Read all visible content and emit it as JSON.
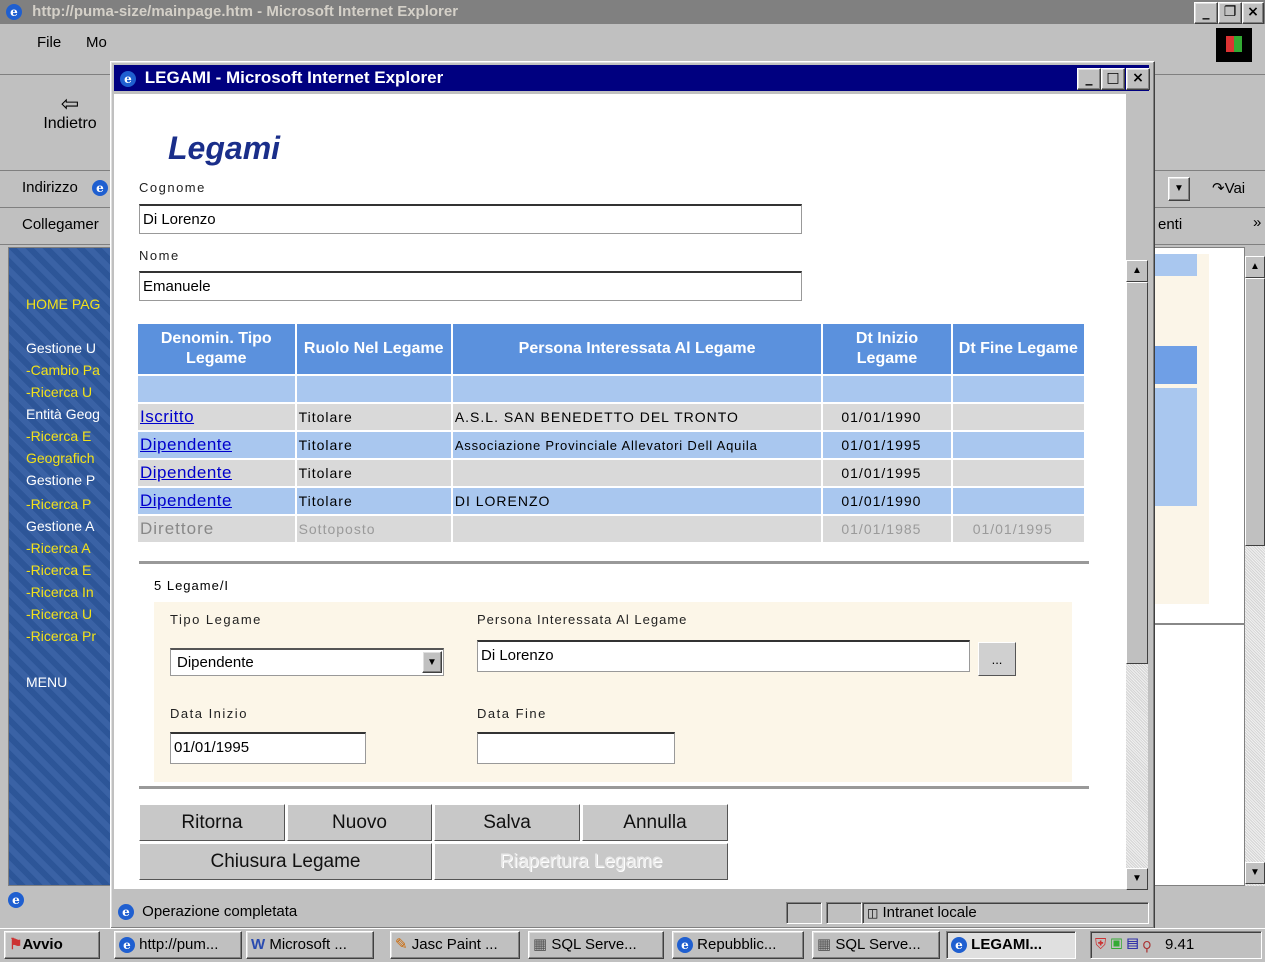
{
  "outer_window": {
    "title": "http://puma-size/mainpage.htm - Microsoft Internet Explorer",
    "menu": [
      "File",
      "Mo"
    ],
    "back_label": "Indietro",
    "address_label": "Indirizzo",
    "go_label": "Vai",
    "links_label": "Collegamer",
    "links_right": "enti",
    "status_text": "",
    "left_menu": [
      {
        "text": "HOME PAG",
        "color": "yellow"
      },
      {
        "text": "Gestione U",
        "color": "white"
      },
      {
        "text": "-Cambio Pa",
        "color": "yellow"
      },
      {
        "text": "-Ricerca U",
        "color": "yellow"
      },
      {
        "text": "Entità Geog",
        "color": "white"
      },
      {
        "text": "-Ricerca E",
        "color": "yellow"
      },
      {
        "text": "Geografich",
        "color": "yellow"
      },
      {
        "text": "Gestione P",
        "color": "white"
      },
      {
        "text": "-Ricerca P",
        "color": "yellow"
      },
      {
        "text": "Gestione A",
        "color": "white"
      },
      {
        "text": "-Ricerca A",
        "color": "yellow"
      },
      {
        "text": "-Ricerca E",
        "color": "yellow"
      },
      {
        "text": "-Ricerca In",
        "color": "yellow"
      },
      {
        "text": "-Ricerca U",
        "color": "yellow"
      },
      {
        "text": "-Ricerca Pr",
        "color": "yellow"
      },
      {
        "text": "MENU",
        "color": "white"
      }
    ]
  },
  "popup": {
    "title": "LEGAMI - Microsoft Internet Explorer",
    "heading": "Legami",
    "cognome_label": "Cognome",
    "cognome_value": "Di Lorenzo",
    "nome_label": "Nome",
    "nome_value": "Emanuele",
    "table": {
      "headers": [
        "Denomin. Tipo Legame",
        "Ruolo Nel Legame",
        "Persona Interessata Al Legame",
        "Dt Inizio Legame",
        "Dt Fine Legame"
      ],
      "rows": [
        {
          "tipo": "Iscritto",
          "ruolo": "Titolare",
          "persona": "A.S.L. SAN BENEDETTO DEL TRONTO",
          "inizio": "01/01/1990",
          "fine": ""
        },
        {
          "tipo": "Dipendente",
          "ruolo": "Titolare",
          "persona": "Associazione Provinciale Allevatori Dell Aquila",
          "inizio": "01/01/1995",
          "fine": ""
        },
        {
          "tipo": "Dipendente",
          "ruolo": "Titolare",
          "persona": "",
          "inizio": "01/01/1995",
          "fine": ""
        },
        {
          "tipo": "Dipendente",
          "ruolo": "Titolare",
          "persona": "DI LORENZO",
          "inizio": "01/01/1990",
          "fine": ""
        },
        {
          "tipo": "Direttore",
          "ruolo": "Sottoposto",
          "persona": "",
          "inizio": "01/01/1985",
          "fine": "01/01/1995"
        }
      ]
    },
    "count_text": "5 Legame/I",
    "form": {
      "tipo_label": "Tipo Legame",
      "tipo_value": "Dipendente",
      "persona_label": "Persona Interessata Al Legame",
      "persona_value": "Di Lorenzo",
      "browse_label": "...",
      "data_inizio_label": "Data Inizio",
      "data_inizio_value": "01/01/1995",
      "data_fine_label": "Data Fine",
      "data_fine_value": ""
    },
    "buttons": {
      "ritorna": "Ritorna",
      "nuovo": "Nuovo",
      "salva": "Salva",
      "annulla": "Annulla",
      "chiusura": "Chiusura Legame",
      "riapertura": "Riapertura Legame"
    },
    "status_text": "Operazione completata",
    "zone_text": "Intranet locale"
  },
  "taskbar": {
    "start": "Avvio",
    "items": [
      "http://pum...",
      "Microsoft ...",
      "Jasc Paint ...",
      "SQL Serve...",
      "Repubblic...",
      "SQL Serve...",
      "LEGAMI..."
    ],
    "clock": "9.41"
  }
}
